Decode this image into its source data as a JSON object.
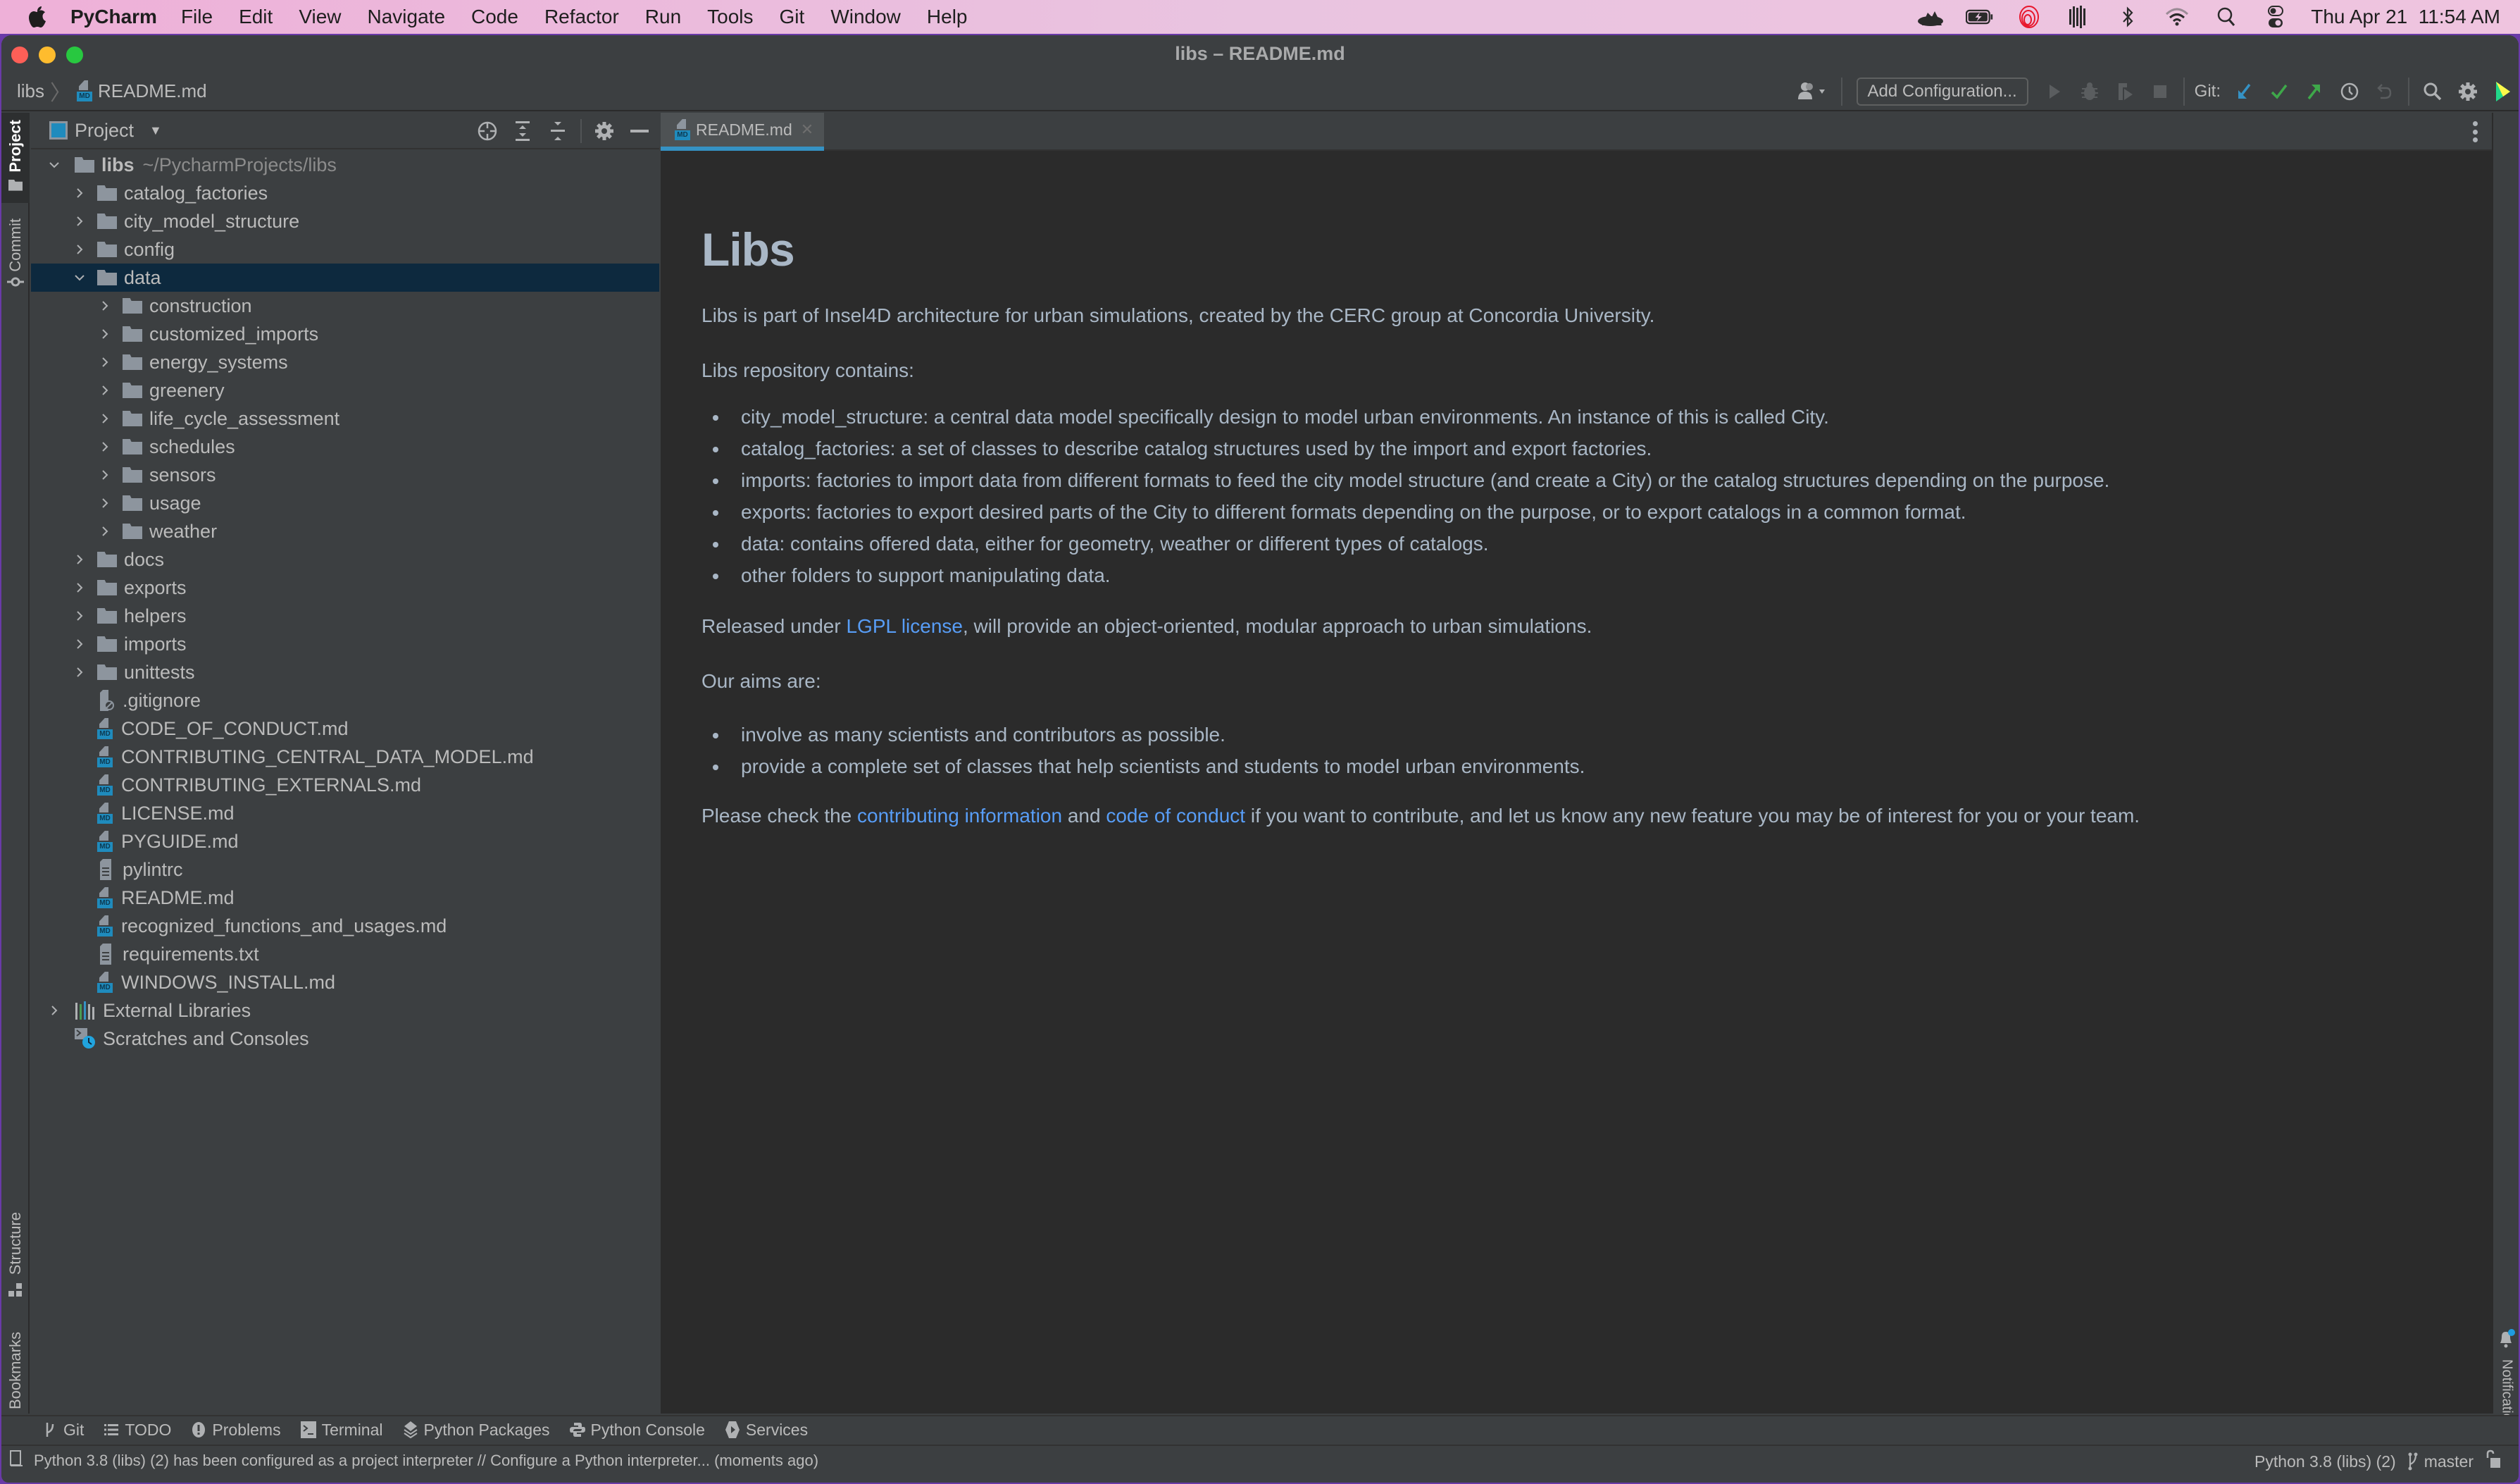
{
  "menubar": {
    "app_name": "PyCharm",
    "items": [
      "File",
      "Edit",
      "View",
      "Navigate",
      "Code",
      "Refactor",
      "Run",
      "Tools",
      "Git",
      "Window",
      "Help"
    ],
    "status_icons": [
      "cloud-icon",
      "battery-charging-icon",
      "cast-icon",
      "audio-bars-icon",
      "bluetooth-icon",
      "wifi-icon",
      "spotlight-search-icon",
      "control-center-icon"
    ],
    "clock": "Thu Apr 21  11:54 AM"
  },
  "window": {
    "title": "libs – README.md"
  },
  "navbar": {
    "breadcrumb": [
      "libs",
      "README.md"
    ],
    "add_configuration": "Add Configuration...",
    "git_label": "Git:"
  },
  "left_stripe": {
    "top_tabs": [
      "Project",
      "Commit"
    ],
    "bottom_tabs": [
      "Structure",
      "Bookmarks"
    ]
  },
  "project_panel": {
    "title": "Project",
    "root": {
      "name": "libs",
      "path": "~/PycharmProjects/libs"
    },
    "items": [
      {
        "name": "catalog_factories",
        "type": "folder",
        "depth": 1,
        "expanded": false
      },
      {
        "name": "city_model_structure",
        "type": "folder",
        "depth": 1,
        "expanded": false
      },
      {
        "name": "config",
        "type": "folder",
        "depth": 1,
        "expanded": false
      },
      {
        "name": "data",
        "type": "folder",
        "depth": 1,
        "expanded": true,
        "selected": true
      },
      {
        "name": "construction",
        "type": "folder",
        "depth": 2,
        "expanded": false
      },
      {
        "name": "customized_imports",
        "type": "folder",
        "depth": 2,
        "expanded": false
      },
      {
        "name": "energy_systems",
        "type": "folder",
        "depth": 2,
        "expanded": false
      },
      {
        "name": "greenery",
        "type": "folder",
        "depth": 2,
        "expanded": false
      },
      {
        "name": "life_cycle_assessment",
        "type": "folder",
        "depth": 2,
        "expanded": false
      },
      {
        "name": "schedules",
        "type": "folder",
        "depth": 2,
        "expanded": false
      },
      {
        "name": "sensors",
        "type": "folder",
        "depth": 2,
        "expanded": false
      },
      {
        "name": "usage",
        "type": "folder",
        "depth": 2,
        "expanded": false
      },
      {
        "name": "weather",
        "type": "folder",
        "depth": 2,
        "expanded": false
      },
      {
        "name": "docs",
        "type": "folder",
        "depth": 1,
        "expanded": false
      },
      {
        "name": "exports",
        "type": "folder",
        "depth": 1,
        "expanded": false
      },
      {
        "name": "helpers",
        "type": "folder",
        "depth": 1,
        "expanded": false
      },
      {
        "name": "imports",
        "type": "folder",
        "depth": 1,
        "expanded": false
      },
      {
        "name": "unittests",
        "type": "folder",
        "depth": 1,
        "expanded": false
      },
      {
        "name": ".gitignore",
        "type": "ignore",
        "depth": 1
      },
      {
        "name": "CODE_OF_CONDUCT.md",
        "type": "md",
        "depth": 1
      },
      {
        "name": "CONTRIBUTING_CENTRAL_DATA_MODEL.md",
        "type": "md",
        "depth": 1
      },
      {
        "name": "CONTRIBUTING_EXTERNALS.md",
        "type": "md",
        "depth": 1
      },
      {
        "name": "LICENSE.md",
        "type": "md",
        "depth": 1
      },
      {
        "name": "PYGUIDE.md",
        "type": "md",
        "depth": 1
      },
      {
        "name": "pylintrc",
        "type": "text",
        "depth": 1
      },
      {
        "name": "README.md",
        "type": "md",
        "depth": 1
      },
      {
        "name": "recognized_functions_and_usages.md",
        "type": "md",
        "depth": 1
      },
      {
        "name": "requirements.txt",
        "type": "text",
        "depth": 1
      },
      {
        "name": "WINDOWS_INSTALL.md",
        "type": "md",
        "depth": 1
      }
    ],
    "external_libraries": "External Libraries",
    "scratches": "Scratches and Consoles"
  },
  "editor": {
    "tab": "README.md",
    "doc": {
      "heading": "Libs",
      "intro": "Libs is part of Insel4D architecture for urban simulations, created by the CERC group at Concordia University.",
      "contains_label": "Libs repository contains:",
      "contains": [
        "city_model_structure: a central data model specifically design to model urban environments. An instance of this is called City.",
        "catalog_factories: a set of classes to describe catalog structures used by the import and export factories.",
        "imports: factories to import data from different formats to feed the city model structure (and create a City) or the catalog structures depending on the purpose.",
        "exports: factories to export desired parts of the City to different formats depending on the purpose, or to export catalogs in a common format.",
        "data: contains offered data, either for geometry, weather or different types of catalogs.",
        "other folders to support manipulating data."
      ],
      "release_pre": "Released under ",
      "release_link": "LGPL license",
      "release_post": ", will provide an object-oriented, modular approach to urban simulations.",
      "aims_label": "Our aims are:",
      "aims": [
        "involve as many scientists and contributors as possible.",
        "provide a complete set of classes that help scientists and students to model urban environments."
      ],
      "check_pre": "Please check the ",
      "check_link1": "contributing information",
      "check_mid": " and ",
      "check_link2": "code of conduct",
      "check_post": " if you want to contribute, and let us know any new feature you may be of interest for you or your team."
    }
  },
  "right_stripe": {
    "notifications": "Notifications"
  },
  "tool_windows": [
    "Git",
    "TODO",
    "Problems",
    "Terminal",
    "Python Packages",
    "Python Console",
    "Services"
  ],
  "status_bar": {
    "message": "Python 3.8 (libs) (2) has been configured as a project interpreter // Configure a Python interpreter... (moments ago)",
    "interpreter": "Python 3.8 (libs) (2)",
    "branch": "master"
  },
  "colors": {
    "accent": "#3592c4",
    "link": "#589df6",
    "selection": "#0d293e",
    "editor_bg": "#2b2b2b",
    "panel_bg": "#3c3f41"
  }
}
